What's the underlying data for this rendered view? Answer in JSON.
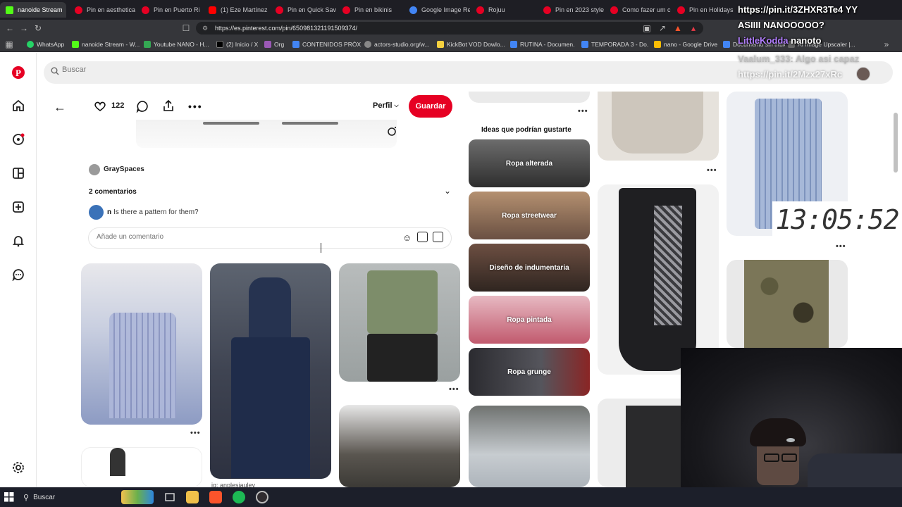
{
  "browser": {
    "tabs": [
      {
        "label": "nanoide Stream",
        "color": "#53fc18"
      },
      {
        "label": "Pin en aesthetica",
        "color": "#e60023"
      },
      {
        "label": "Pin en Puerto Ri",
        "color": "#e60023"
      },
      {
        "label": "(1) Eze Martínez",
        "color": "#ff0000"
      },
      {
        "label": "Pin en Quick Save",
        "color": "#e60023"
      },
      {
        "label": "Pin en bikinis",
        "color": "#e60023"
      },
      {
        "label": "Google Image Re",
        "color": "#4285f4"
      },
      {
        "label": "Rojuu",
        "color": "#e60023"
      },
      {
        "label": "Pin en 2023 style",
        "color": "#e60023"
      },
      {
        "label": "Como fazer um c",
        "color": "#e60023"
      },
      {
        "label": "Pin en Holidays",
        "color": "#e60023"
      }
    ],
    "url": "https://es.pinterest.com/pin/650981321191509374/",
    "bookmarks": [
      {
        "label": "WhatsApp",
        "color": "#25d366"
      },
      {
        "label": "nanoide Stream - W...",
        "color": "#53fc18"
      },
      {
        "label": "Youtube NANO - H...",
        "color": "#34a853"
      },
      {
        "label": "(2) Inicio / X",
        "color": "#000000"
      },
      {
        "label": "Org",
        "color": "#9b59b6"
      },
      {
        "label": "CONTENIDOS PRÓX...",
        "color": "#4285f4"
      },
      {
        "label": "actors-studio.org/w...",
        "color": "#888888"
      },
      {
        "label": "KickBot VOD Dowlo...",
        "color": "#f4d03f"
      },
      {
        "label": "RUTINA - Documen...",
        "color": "#4285f4"
      },
      {
        "label": "TEMPORADA 3 - Do...",
        "color": "#4285f4"
      },
      {
        "label": "nano - Google Drive",
        "color": "#fbbc04"
      },
      {
        "label": "Documento sin título",
        "color": "#4285f4"
      },
      {
        "label": "AI Image Upscaler |...",
        "color": "#666666"
      }
    ]
  },
  "pinterest": {
    "search_placeholder": "Buscar",
    "likes": "122",
    "profile_label": "Perfil",
    "save_label": "Guardar",
    "author": "GraySpaces",
    "comments_header": "2 comentarios",
    "comment_user": "n",
    "comment_text": "Is there a pattern for them?",
    "comment_placeholder": "Añade un comentario",
    "ideas_title": "Ideas que podrían gustarte",
    "ideas": [
      {
        "label": "Ropa alterada",
        "color": "#4a4a4a"
      },
      {
        "label": "Ropa streetwear",
        "color": "#8a6a55"
      },
      {
        "label": "Diseño de indumentaria",
        "color": "#5a3f32"
      },
      {
        "label": "Ropa pintada",
        "color": "#c99aa4"
      },
      {
        "label": "Ropa grunge",
        "color": "#3c3c40"
      }
    ],
    "grid_caption": "ig: anplesiauley"
  },
  "overlay": {
    "chat": [
      {
        "user": "",
        "text": "https://pin.it/3ZHXR3Te4 YY"
      },
      {
        "user": "",
        "text": "ASIIII NANOOOOO?"
      },
      {
        "user": "LittleKodda",
        "text": "nanoto"
      },
      {
        "user": "Vaalum_333",
        "text": "Algo asi capaz"
      },
      {
        "user": "",
        "text": "https://pin.it/2Mzx27xRc"
      }
    ],
    "clock": "13:05:52"
  },
  "taskbar": {
    "search_label": "Buscar"
  }
}
